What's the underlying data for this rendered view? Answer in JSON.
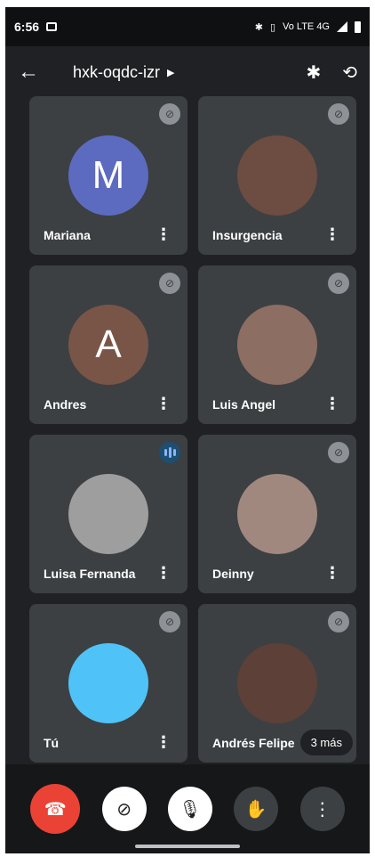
{
  "status_bar": {
    "time": "6:56",
    "right_text": "Vo LTE 4G"
  },
  "header": {
    "meeting_code": "hxk-oqdc-izr",
    "back_icon": "arrow-left-icon",
    "bluetooth_icon": "bluetooth-icon",
    "switch_camera_icon": "switch-camera-icon"
  },
  "participants": [
    {
      "name": "Mariana",
      "initial": "M",
      "avatar_color": "#5c6bc0",
      "muted": true
    },
    {
      "name": "Insurgencia",
      "initial": "",
      "avatar_color": "#6d4c41",
      "muted": true
    },
    {
      "name": "Andres",
      "initial": "A",
      "avatar_color": "#795548",
      "muted": true
    },
    {
      "name": "Luis Angel",
      "initial": "",
      "avatar_color": "#8d6e63",
      "muted": true
    },
    {
      "name": "Luisa Fernanda",
      "initial": "",
      "avatar_color": "#9e9e9e",
      "muted": false,
      "speaking": true
    },
    {
      "name": "Deinny",
      "initial": "",
      "avatar_color": "#a1887f",
      "muted": true
    },
    {
      "name": "Tú",
      "initial": "",
      "avatar_color": "#4fc3f7",
      "muted": true
    },
    {
      "name": "Andrés Felipe",
      "initial": "",
      "avatar_color": "#5d4037",
      "muted": true
    }
  ],
  "more_participants": "3 más",
  "controls": {
    "end_call_icon": "end-call-icon",
    "camera_off_icon": "camera-off-icon",
    "mic_off_icon": "mic-off-icon",
    "raise_hand_icon": "raise-hand-icon",
    "more_icon": "more-icon"
  }
}
